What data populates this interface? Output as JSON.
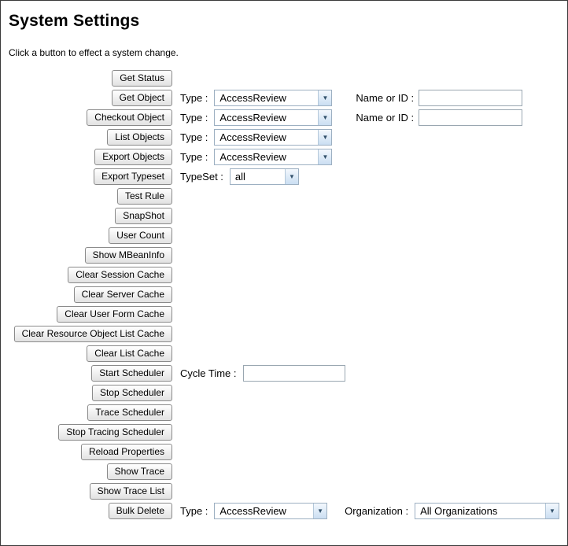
{
  "page": {
    "title": "System Settings",
    "subtitle": "Click a button to effect a system change."
  },
  "rows": [
    {
      "button": "Get Status"
    },
    {
      "button": "Get Object",
      "type_label": "Type :",
      "type_value": "AccessReview",
      "name_label": "Name or ID :",
      "name_value": ""
    },
    {
      "button": "Checkout Object",
      "type_label": "Type :",
      "type_value": "AccessReview",
      "name_label": "Name or ID :",
      "name_value": ""
    },
    {
      "button": "List Objects",
      "type_label": "Type :",
      "type_value": "AccessReview"
    },
    {
      "button": "Export Objects",
      "type_label": "Type :",
      "type_value": "AccessReview"
    },
    {
      "button": "Export Typeset",
      "typeset_label": "TypeSet :",
      "typeset_value": "all"
    },
    {
      "button": "Test Rule"
    },
    {
      "button": "SnapShot"
    },
    {
      "button": "User Count"
    },
    {
      "button": "Show MBeanInfo"
    },
    {
      "button": "Clear Session Cache"
    },
    {
      "button": "Clear Server Cache"
    },
    {
      "button": "Clear User Form Cache"
    },
    {
      "button": "Clear Resource Object List Cache"
    },
    {
      "button": "Clear List Cache"
    },
    {
      "button": "Start Scheduler",
      "cycle_label": "Cycle Time :",
      "cycle_value": ""
    },
    {
      "button": "Stop Scheduler"
    },
    {
      "button": "Trace Scheduler"
    },
    {
      "button": "Stop Tracing Scheduler"
    },
    {
      "button": "Reload Properties"
    },
    {
      "button": "Show Trace"
    },
    {
      "button": "Show Trace List"
    },
    {
      "button": "Bulk Delete",
      "type_label": "Type :",
      "type_value": "AccessReview",
      "org_label": "Organization :",
      "org_value": "All Organizations"
    }
  ]
}
